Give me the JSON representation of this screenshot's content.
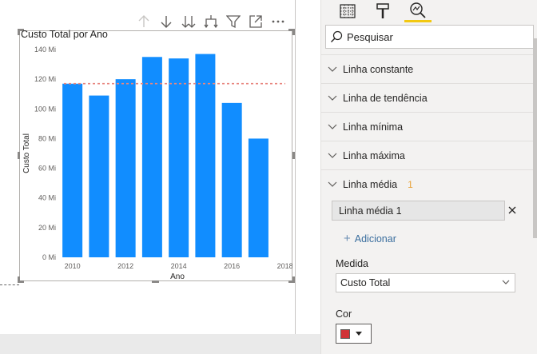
{
  "visual_header": {
    "icons": [
      "arrow-up-icon",
      "arrow-down-icon",
      "double-arrow-down-icon",
      "expand-hierarchy-icon",
      "filter-icon",
      "focus-mode-icon",
      "more-options-icon"
    ]
  },
  "chart_data": {
    "type": "bar",
    "title": "Custo Total por Ano",
    "xlabel": "Ano",
    "ylabel": "Custo Total",
    "x_ticks": [
      "2010",
      "2012",
      "2014",
      "2016",
      "2018"
    ],
    "y_ticks": [
      "0 Mi",
      "20 Mi",
      "40 Mi",
      "60 Mi",
      "80 Mi",
      "100 Mi",
      "120 Mi",
      "140 Mi"
    ],
    "ylim": [
      0,
      140
    ],
    "x": [
      2010,
      2011,
      2012,
      2013,
      2014,
      2015,
      2016,
      2017
    ],
    "values": [
      117,
      109,
      120,
      135,
      134,
      137,
      104,
      80
    ],
    "bar_color": "#118dff",
    "average_line": {
      "value": 117,
      "color": "#e8867f",
      "style": "dashed"
    }
  },
  "pane": {
    "tabs": [
      {
        "icon": "fields-grid-icon",
        "selected": false
      },
      {
        "icon": "format-paint-roller-icon",
        "selected": false
      },
      {
        "icon": "analytics-magnifier-icon",
        "selected": true
      }
    ],
    "search_placeholder": "Pesquisar",
    "sections": [
      {
        "label": "Linha constante",
        "badge": ""
      },
      {
        "label": "Linha de tendência",
        "badge": ""
      },
      {
        "label": "Linha mínima",
        "badge": ""
      },
      {
        "label": "Linha máxima",
        "badge": ""
      },
      {
        "label": "Linha média",
        "badge": "1"
      }
    ],
    "line_item": "Linha média 1",
    "add_label": "Adicionar",
    "measure_label": "Medida",
    "measure_value": "Custo Total",
    "color_label": "Cor",
    "color_value": "#d13438"
  }
}
